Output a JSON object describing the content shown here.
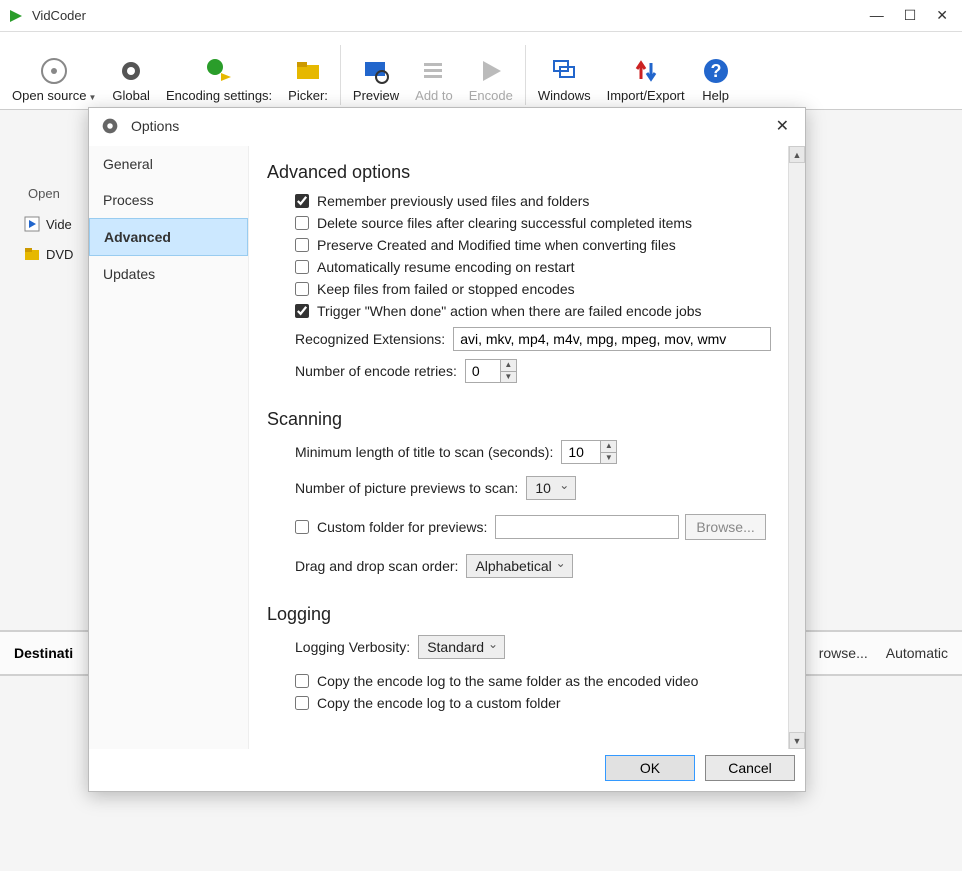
{
  "app": {
    "title": "VidCoder"
  },
  "toolbar": {
    "open_source": "Open source",
    "global": "Global",
    "encoding_settings": "Encoding settings:",
    "picker": "Picker:",
    "preview": "Preview",
    "add_to": "Add to",
    "encode": "Encode",
    "windows": "Windows",
    "import_export": "Import/Export",
    "help": "Help"
  },
  "main": {
    "open_label": "Open",
    "items": [
      {
        "label": "Vide"
      },
      {
        "label": "DVD"
      }
    ]
  },
  "dest": {
    "label": "Destinati",
    "browse": "rowse...",
    "auto": "Automatic"
  },
  "dialog": {
    "title": "Options",
    "sidebar": {
      "items": [
        "General",
        "Process",
        "Advanced",
        "Updates"
      ],
      "active": 2
    },
    "sections": {
      "advanced": {
        "title": "Advanced options",
        "chk_remember": "Remember previously used files and folders",
        "chk_delete_source": "Delete source files after clearing successful completed items",
        "chk_preserve_time": "Preserve Created and Modified time when converting files",
        "chk_auto_resume": "Automatically resume encoding on restart",
        "chk_keep_failed": "Keep files from failed or stopped encodes",
        "chk_trigger_when_done": "Trigger \"When done\" action when there are failed encode jobs",
        "recognized_ext_label": "Recognized Extensions:",
        "recognized_ext_value": "avi, mkv, mp4, m4v, mpg, mpeg, mov, wmv",
        "retries_label": "Number of encode retries:",
        "retries_value": "0"
      },
      "scanning": {
        "title": "Scanning",
        "min_length_label": "Minimum length of title to scan (seconds):",
        "min_length_value": "10",
        "previews_label": "Number of picture previews to scan:",
        "previews_value": "10",
        "custom_folder_previews": "Custom folder for previews:",
        "custom_folder_value": "",
        "browse": "Browse...",
        "drag_drop_label": "Drag and drop scan order:",
        "drag_drop_value": "Alphabetical"
      },
      "logging": {
        "title": "Logging",
        "verbosity_label": "Logging Verbosity:",
        "verbosity_value": "Standard",
        "chk_copy_same": "Copy the encode log to the same folder as the encoded video",
        "chk_copy_custom": "Copy the encode log to a custom folder"
      }
    },
    "buttons": {
      "ok": "OK",
      "cancel": "Cancel"
    }
  }
}
